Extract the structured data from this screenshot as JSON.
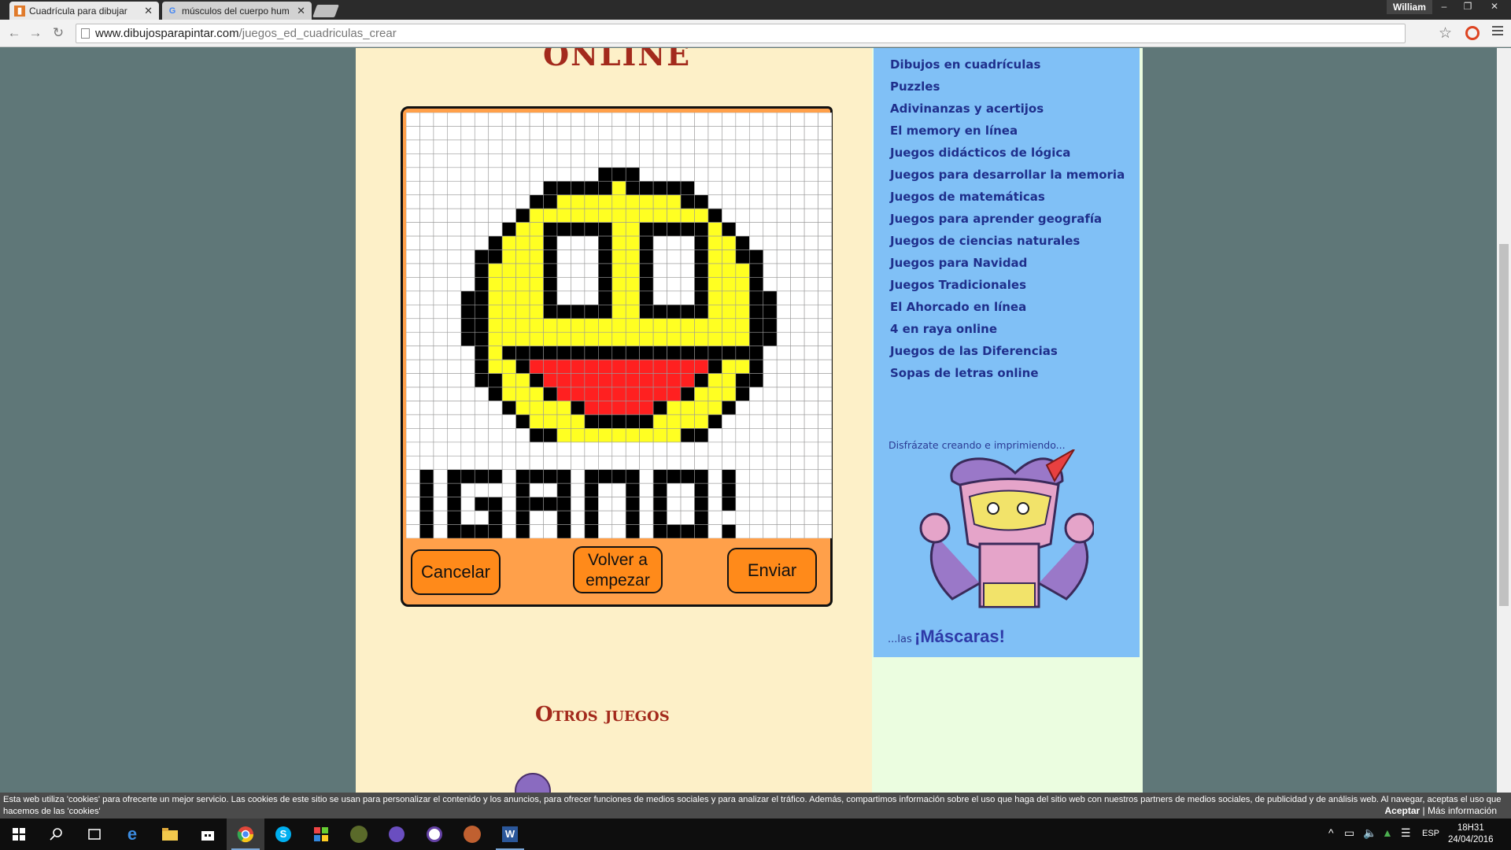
{
  "browser": {
    "tabs": [
      {
        "title": "Cuadrícula para dibujar",
        "active": true
      },
      {
        "title": "músculos del cuerpo hum",
        "active": false
      }
    ],
    "user": "William",
    "url_host": "www.dibujosparapintar.com",
    "url_path": "/juegos_ed_cuadriculas_crear"
  },
  "page": {
    "heading_top": "ONLINE",
    "game": {
      "win_text": "¡GANO!",
      "buttons": {
        "cancel": "Cancelar",
        "restart_line1": "Volver a",
        "restart_line2": "empezar",
        "send": "Enviar"
      },
      "colors": {
        "yellow": "#ffff22",
        "black": "#000000",
        "red": "#ff2020",
        "frame": "#ffa04a"
      }
    },
    "other_games_title": "Otros juegos",
    "sidebar_links": [
      "Dibujos en cuadrículas",
      "Puzzles",
      "Adivinanzas y acertijos",
      "El memory en línea",
      "Juegos didácticos de lógica",
      "Juegos para desarrollar la memoria",
      "Juegos de matemáticas",
      "Juegos para aprender geografía",
      "Juegos de ciencias naturales",
      "Juegos para Navidad",
      "Juegos Tradicionales",
      "El Ahorcado en línea",
      "4 en raya online",
      "Juegos de las Diferencias",
      "Sopas de letras online"
    ],
    "promo": {
      "top": "Disfrázate creando e imprimiendo...",
      "pre": "...las",
      "highlight": "¡Máscaras!"
    }
  },
  "cookie": {
    "text": "Esta web utiliza 'cookies' para ofrecerte un mejor servicio. Las cookies de este sitio se usan para personalizar el contenido y los anuncios, para ofrecer funciones de medios sociales y para analizar el tráfico. Además, compartimos información sobre el uso que haga del sitio web con nuestros partners de medios sociales, de publicidad y de análisis web. Al navegar, aceptas el uso que hacemos de las 'cookies'",
    "accept": "Aceptar",
    "more": "Más información"
  },
  "taskbar": {
    "lang": "ESP",
    "time": "18H31",
    "date": "24/04/2016"
  }
}
